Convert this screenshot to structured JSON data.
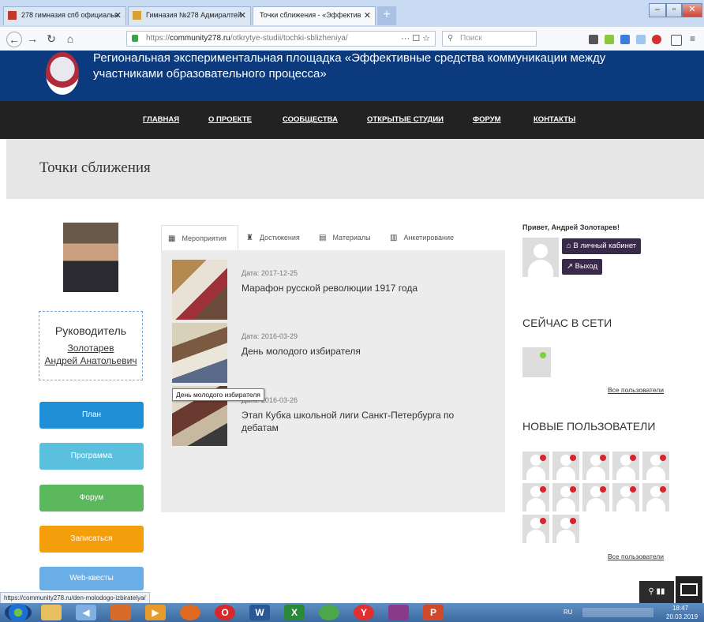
{
  "browser": {
    "tabs": [
      {
        "label": "278 гимназия спб официальн"
      },
      {
        "label": "Гимназия №278 Адмиралтей"
      },
      {
        "label": "Точки сближения - «Эффектив"
      }
    ],
    "url_prefix": "https://",
    "url_host": "community278.ru",
    "url_path": "/otkrytye-studii/tochki-sblizheniya/",
    "url_tools": "··· ☐ ☆",
    "search_placeholder": "Поиск",
    "status_url": "https://community278.ru/den-molodogo-izbiratelya/"
  },
  "site": {
    "title": "Региональная экспериментальная площадка «Эффективные средства коммуникации между участниками образовательного процесса»",
    "nav": [
      "ГЛАВНАЯ",
      "О ПРОЕКТЕ",
      "СООБЩЕСТВА",
      "ОТКРЫТЫЕ СТУДИИ",
      "ФОРУМ",
      "КОНТАКТЫ"
    ],
    "page_title": "Точки сближения"
  },
  "leader": {
    "role": "Руководитель",
    "name_line1": "Золотарев",
    "name_line2": "Андрей Анатольевич"
  },
  "side_buttons": [
    {
      "label": "План",
      "color": "#1f8fd6"
    },
    {
      "label": "Программа",
      "color": "#5bc0de"
    },
    {
      "label": "Форум",
      "color": "#5cb85c"
    },
    {
      "label": "Записаться",
      "color": "#f59e0b"
    },
    {
      "label": "Web-квесты",
      "color": "#6aaee8"
    }
  ],
  "tabs": [
    "Мероприятия",
    "Достижения",
    "Материалы",
    "Анкетирование"
  ],
  "events": [
    {
      "date": "Дата: 2017-12-25",
      "title": "Марафон русской революции 1917 года"
    },
    {
      "date": "Дата: 2016-03-29",
      "title": "День молодого избирателя"
    },
    {
      "date": "Дата: 2016-03-26",
      "title": "Этап Кубка школьной лиги Санкт-Петербурга по дебатам"
    }
  ],
  "tooltip": "День молодого избирателя",
  "user_panel": {
    "greeting": "Привет, Андрей Золотарев!",
    "cabinet_button": "В личный кабинет",
    "logout_button": "Выход"
  },
  "online": {
    "heading": "СЕЙЧАС В СЕТИ",
    "all_link": "Все пользователи"
  },
  "new_users": {
    "heading": "НОВЫЕ ПОЛЬЗОВАТЕЛИ",
    "all_link": "Все пользователи"
  },
  "taskbar": {
    "lang": "RU",
    "time": "18:47",
    "date": "20.03.2019"
  }
}
